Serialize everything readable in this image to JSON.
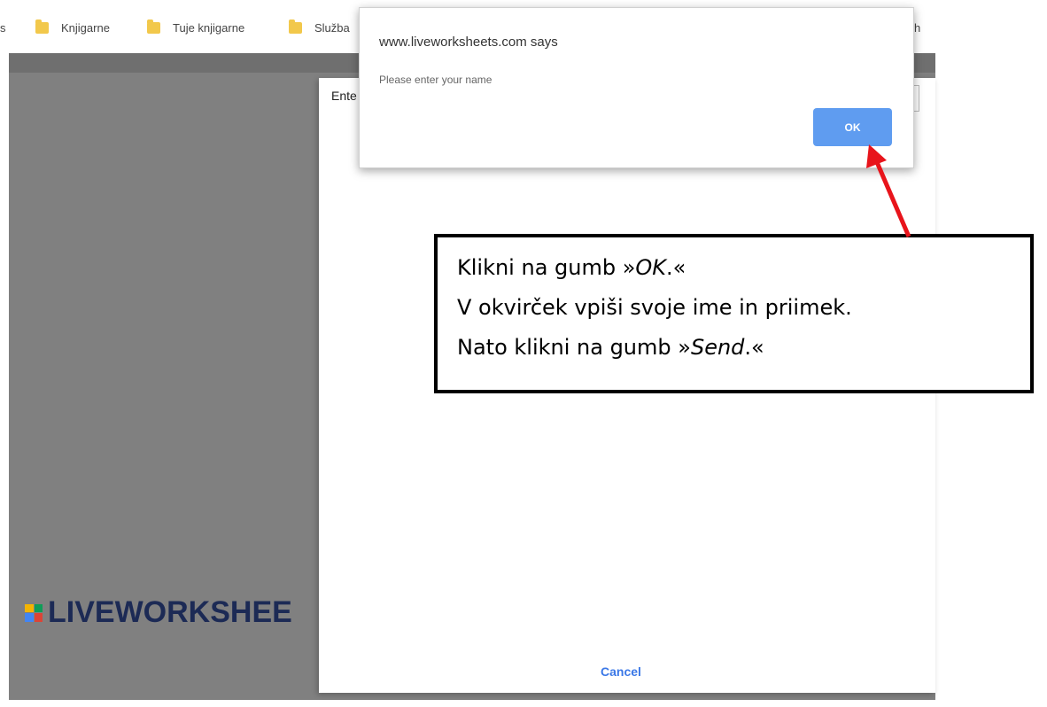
{
  "bookmarks_bar": {
    "items": [
      {
        "label": "s"
      },
      {
        "label": "Knjigarne"
      },
      {
        "label": "Tuje knjigarne"
      },
      {
        "label": "Služba"
      },
      {
        "label": "h"
      }
    ]
  },
  "background_page": {
    "logo_text": "LIVEWORKSHEE"
  },
  "prompt_modal": {
    "title_partial": "Ente",
    "cancel_label": "Cancel"
  },
  "alert_dialog": {
    "title": "www.liveworksheets.com says",
    "message": "Please enter your name",
    "ok_label": "OK"
  },
  "instruction_box": {
    "line1_prefix": "Klikni na gumb »",
    "line1_emph": "OK",
    "line1_suffix": ".«",
    "line2": "V okvirček vpiši svoje ime in priimek.",
    "line3_prefix": "Nato klikni na gumb »",
    "line3_emph": "Send",
    "line3_suffix": ".«"
  },
  "colors": {
    "ok_button": "#5f9cf0",
    "cancel_text": "#3b78e7",
    "arrow": "#e8141b",
    "page_bg": "#808080"
  },
  "icons": [
    "folder-icon",
    "liveworksheets-logo-icon",
    "red-arrow-icon"
  ]
}
